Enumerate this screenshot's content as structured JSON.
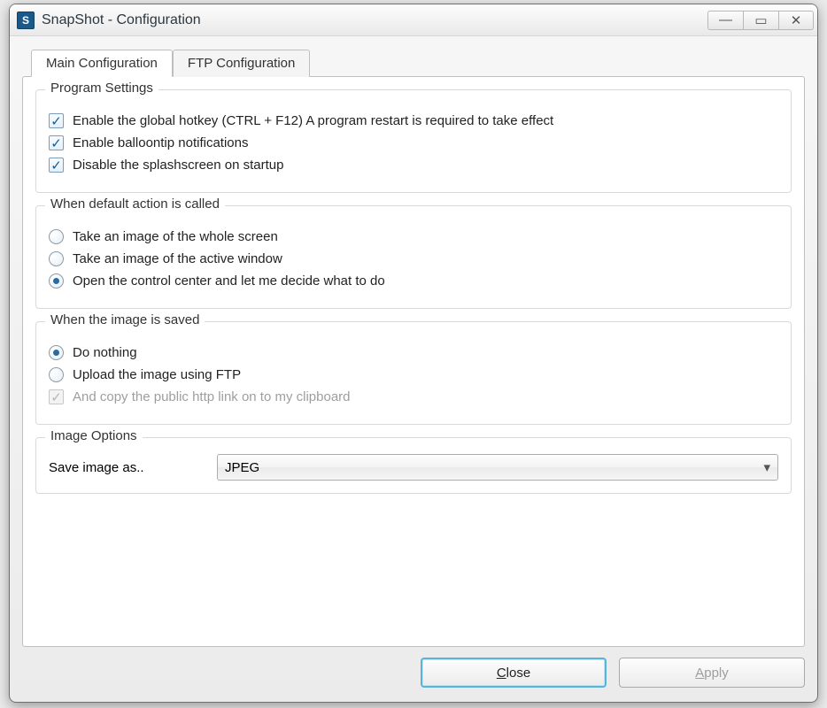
{
  "window": {
    "app_icon_letter": "S",
    "title": "SnapShot - Configuration"
  },
  "tabs": [
    {
      "label": "Main Configuration",
      "active": true
    },
    {
      "label": "FTP Configuration",
      "active": false
    }
  ],
  "program_settings": {
    "legend": "Program Settings",
    "items": [
      {
        "label": "Enable the global hotkey (CTRL + F12) A program restart is required to take effect",
        "checked": true
      },
      {
        "label": "Enable balloontip notifications",
        "checked": true
      },
      {
        "label": "Disable the splashscreen on startup",
        "checked": true
      }
    ]
  },
  "default_action": {
    "legend": "When default action is called",
    "items": [
      {
        "label": "Take an image of the whole screen",
        "selected": false
      },
      {
        "label": "Take an image of the active window",
        "selected": false
      },
      {
        "label": "Open the control center and let me decide what to do",
        "selected": true
      }
    ]
  },
  "when_saved": {
    "legend": "When the image is saved",
    "radios": [
      {
        "label": "Do nothing",
        "selected": true
      },
      {
        "label": "Upload the image using FTP",
        "selected": false
      }
    ],
    "copy_link": {
      "label": "And copy the public http link on to my clipboard",
      "checked": true,
      "disabled": true
    }
  },
  "image_options": {
    "legend": "Image Options",
    "save_label": "Save image as..",
    "format_value": "JPEG"
  },
  "buttons": {
    "close": "Close",
    "apply": "Apply"
  }
}
